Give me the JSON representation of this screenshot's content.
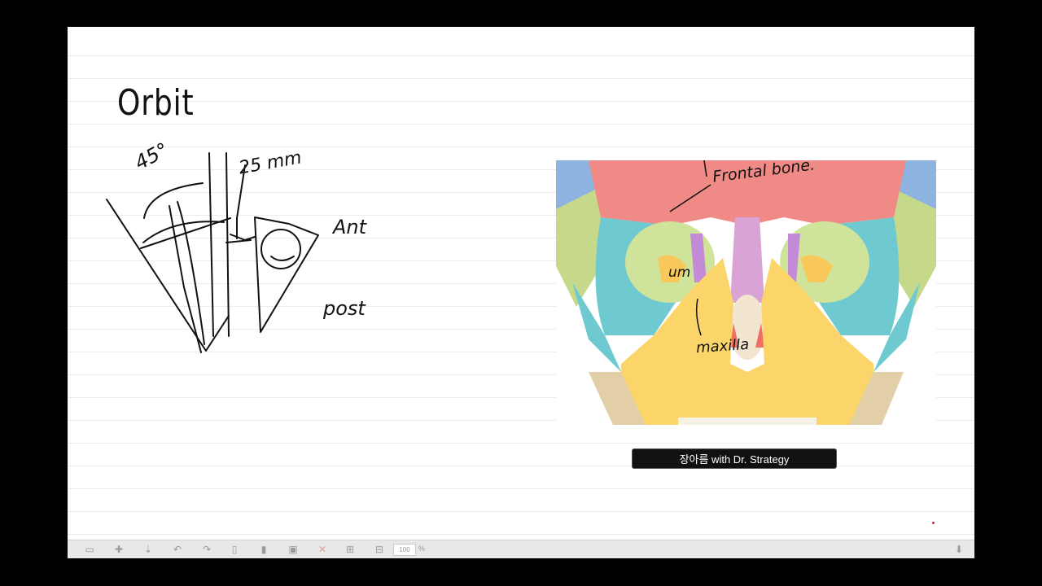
{
  "slide": {
    "title": "Orbit",
    "annotations": {
      "angle": "45°",
      "distance": "25 mm",
      "anterior": "Ant",
      "posterior": "post",
      "frontal_bone": "Frontal bone.",
      "maxilla": "maxilla",
      "mm": "um"
    }
  },
  "caption": "장아름 with Dr. Strategy",
  "toolbar": {
    "zoom_value": "100",
    "zoom_unit": "%",
    "icons": [
      "screen-icon",
      "cursor-add-icon",
      "download-icon",
      "undo-icon",
      "redo-icon",
      "page-icon",
      "copy-page-icon",
      "fit-icon",
      "delete-icon",
      "grid-a-icon",
      "grid-b-icon",
      "expand-icon"
    ]
  },
  "colors": {
    "frontal": "#f08a86",
    "maxilla": "#fcd56a",
    "zygomatic": "#6ecad0",
    "nasal": "#d9a3d6",
    "greenish": "#cfe39a"
  }
}
